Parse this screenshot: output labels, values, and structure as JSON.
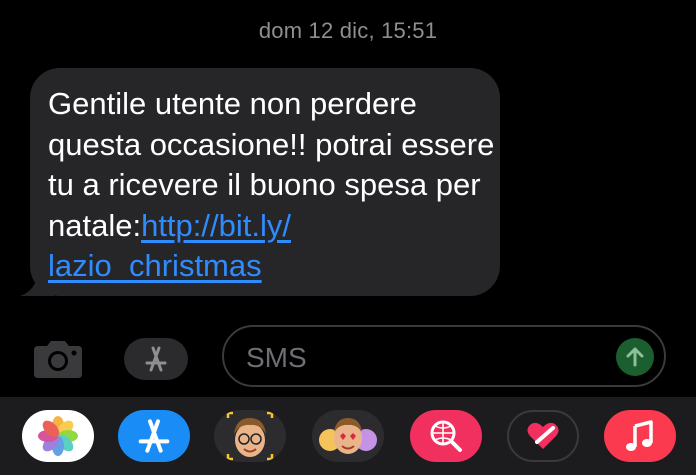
{
  "thread": {
    "timestamp_day": "dom 12 dic,",
    "timestamp_time": "15:51"
  },
  "message": {
    "body": "Gentile utente non perdere questa occasione!! potrai essere tu a ricevere il buono spesa per natale:",
    "link_text": "http://bit.ly/lazio_christmas",
    "link_line1": "http://bit.ly/",
    "link_line2": "lazio_christmas"
  },
  "composer": {
    "placeholder": "SMS"
  },
  "dock": {
    "apps": [
      {
        "name": "Foto",
        "icon": "photos-icon"
      },
      {
        "name": "App Store",
        "icon": "app-store-icon"
      },
      {
        "name": "Memoji",
        "icon": "memoji-icon"
      },
      {
        "name": "Animoji stickers",
        "icon": "memoji-stickers-icon"
      },
      {
        "name": "Ricerca immagini",
        "icon": "image-search-icon"
      },
      {
        "name": "Digital Touch",
        "icon": "digital-touch-icon"
      },
      {
        "name": "Musica",
        "icon": "music-icon"
      }
    ]
  },
  "colors": {
    "background": "#000000",
    "bubble": "#262629",
    "link": "#2f8cff",
    "timestamp": "#8e8e93",
    "send_button": "#1b5e2f"
  }
}
